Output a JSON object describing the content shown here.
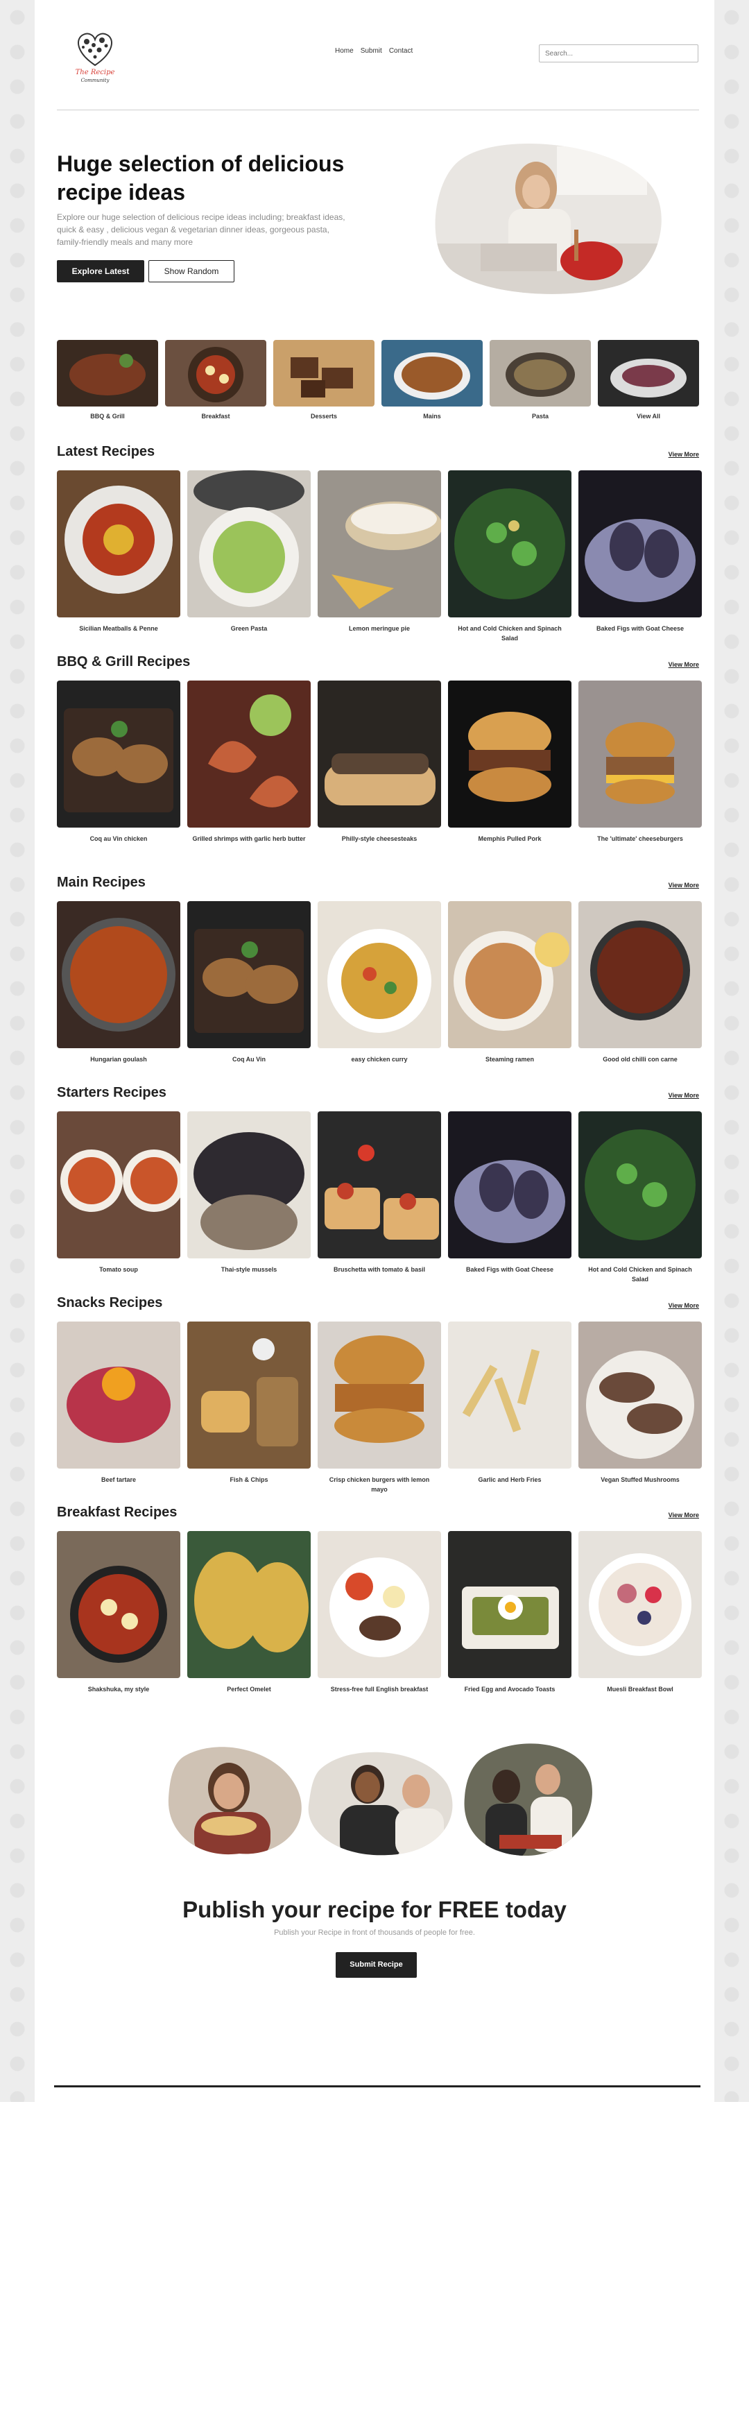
{
  "brand": {
    "logo_line1": "The Recipe",
    "logo_line2": "Community"
  },
  "nav": [
    {
      "label": "Home"
    },
    {
      "label": "Submit"
    },
    {
      "label": "Contact"
    }
  ],
  "search": {
    "placeholder": "Search..."
  },
  "hero": {
    "title": "Huge selection of delicious recipe ideas",
    "text": "Explore our huge selection of delicious recipe ideas including; breakfast ideas, quick & easy , delicious vegan & vegetarian dinner ideas, gorgeous pasta, family-friendly meals and many more",
    "explore_label": "Explore Latest",
    "random_label": "Show Random"
  },
  "categories": [
    {
      "label": "BBQ & Grill",
      "color": "#7a3a22"
    },
    {
      "label": "Breakfast",
      "color": "#3e2a1d"
    },
    {
      "label": "Desserts",
      "color": "#5b3620"
    },
    {
      "label": "Mains",
      "color": "#9a5a2a"
    },
    {
      "label": "Pasta",
      "color": "#8a7550"
    },
    {
      "label": "View All",
      "color": "#2a2a2a"
    }
  ],
  "sections": [
    {
      "title": "Latest Recipes",
      "view_more": "View More",
      "items": [
        {
          "label": "Sicilian Meatballs & Penne",
          "color": "#b33a1e"
        },
        {
          "label": "Green Pasta",
          "color": "#9bc35a"
        },
        {
          "label": "Lemon meringue pie",
          "color": "#d8c7a6"
        },
        {
          "label": "Hot and Cold Chicken and Spinach Salad",
          "color": "#2f5a2a"
        },
        {
          "label": "Baked Figs with Goat Cheese",
          "color": "#3a3550"
        }
      ]
    },
    {
      "title": "BBQ & Grill Recipes",
      "view_more": "View More",
      "items": [
        {
          "label": "Coq au Vin chicken",
          "color": "#9c6b3c"
        },
        {
          "label": "Grilled shrimps with garlic herb butter",
          "color": "#c4603a"
        },
        {
          "label": "Philly-style cheesesteaks",
          "color": "#5a4535"
        },
        {
          "label": "Memphis Pulled Pork",
          "color": "#6b3a22"
        },
        {
          "label": "The 'ultimate' cheeseburgers",
          "color": "#8a5a35"
        }
      ]
    },
    {
      "title": "Main Recipes",
      "view_more": "View More",
      "items": [
        {
          "label": "Hungarian goulash",
          "color": "#b14a1c"
        },
        {
          "label": "Coq Au Vin",
          "color": "#9c6b3c"
        },
        {
          "label": "easy chicken curry",
          "color": "#d6a23a"
        },
        {
          "label": "Steaming ramen",
          "color": "#c98a52"
        },
        {
          "label": "Good old chilli con carne",
          "color": "#6b2a1a"
        }
      ]
    },
    {
      "title": "Starters Recipes",
      "view_more": "View More",
      "items": [
        {
          "label": "Tomato soup",
          "color": "#c9552a"
        },
        {
          "label": "Thai-style mussels",
          "color": "#2e2a30"
        },
        {
          "label": "Bruschetta with tomato & basil",
          "color": "#c2402a"
        },
        {
          "label": "Baked Figs with Goat Cheese",
          "color": "#3a3550"
        },
        {
          "label": "Hot and Cold Chicken and Spinach Salad",
          "color": "#2f5a2a"
        }
      ]
    },
    {
      "title": "Snacks Recipes",
      "view_more": "View More",
      "items": [
        {
          "label": "Beef tartare",
          "color": "#b8344a"
        },
        {
          "label": "Fish & Chips",
          "color": "#a17a4a"
        },
        {
          "label": "Crisp chicken burgers with lemon mayo",
          "color": "#b06a2a"
        },
        {
          "label": "Garlic and Herb Fries",
          "color": "#e0c27a"
        },
        {
          "label": "Vegan Stuffed Mushrooms",
          "color": "#6a4a3a"
        }
      ]
    },
    {
      "title": "Breakfast Recipes",
      "view_more": "View More",
      "items": [
        {
          "label": "Shakshuka, my style",
          "color": "#a8341e"
        },
        {
          "label": "Perfect Omelet",
          "color": "#d9b24a"
        },
        {
          "label": "Stress-free full English breakfast",
          "color": "#5a3a2a"
        },
        {
          "label": "Fried Egg and Avocado Toasts",
          "color": "#7a8a3a"
        },
        {
          "label": "Muesli Breakfast Bowl",
          "color": "#c46a7a"
        }
      ]
    }
  ],
  "publish": {
    "title": "Publish your recipe for FREE today",
    "subtitle": "Publish your Recipe in front of thousands of people for free.",
    "button_label": "Submit Recipe"
  },
  "colors": {
    "accent": "#222222",
    "brand_red": "#d8423a",
    "rule": "#cfcfcf"
  }
}
